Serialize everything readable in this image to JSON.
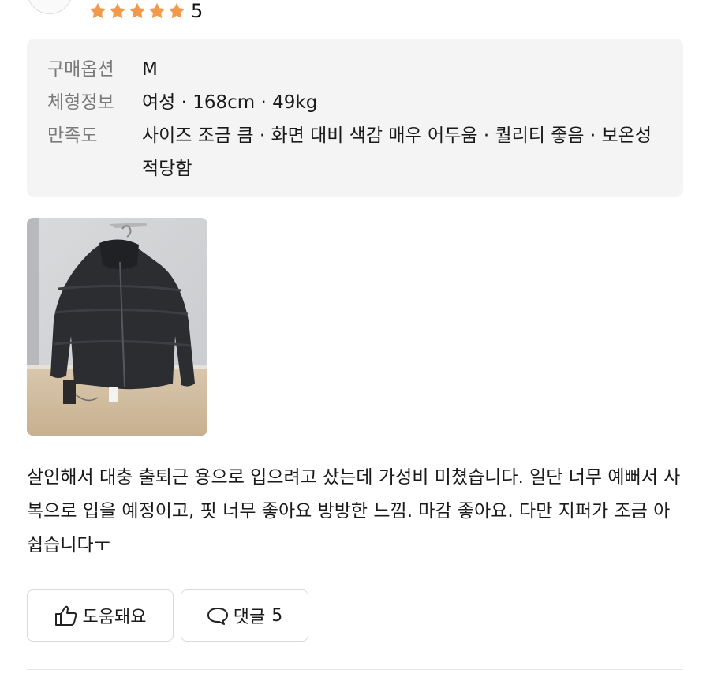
{
  "review": {
    "rating": {
      "stars": 5,
      "max": 5,
      "score_text": "5",
      "star_color": "#f2994a"
    },
    "info": [
      {
        "label": "구매옵션",
        "value": "M"
      },
      {
        "label": "체형정보",
        "value": "여성 · 168cm · 49kg"
      },
      {
        "label": "만족도",
        "value": "사이즈 조금 큼 · 화면 대비 색감 매우 어두움 · 퀄리티 좋음 · 보온성 적당함"
      }
    ],
    "photo": {
      "subject": "black-cropped-puffer-jacket-on-hanger"
    },
    "body": "살인해서 대충 출퇴근 용으로 입으려고 샀는데 가성비 미쳤습니다. 일단 너무 예뻐서 사복으로 입을 예정이고, 핏 너무 좋아요 방방한 느낌. 마감 좋아요. 다만 지퍼가 조금 아쉽습니다ㅜ",
    "actions": {
      "helpful_label": "도움돼요",
      "comment_label": "댓글",
      "comment_count": "5"
    }
  }
}
